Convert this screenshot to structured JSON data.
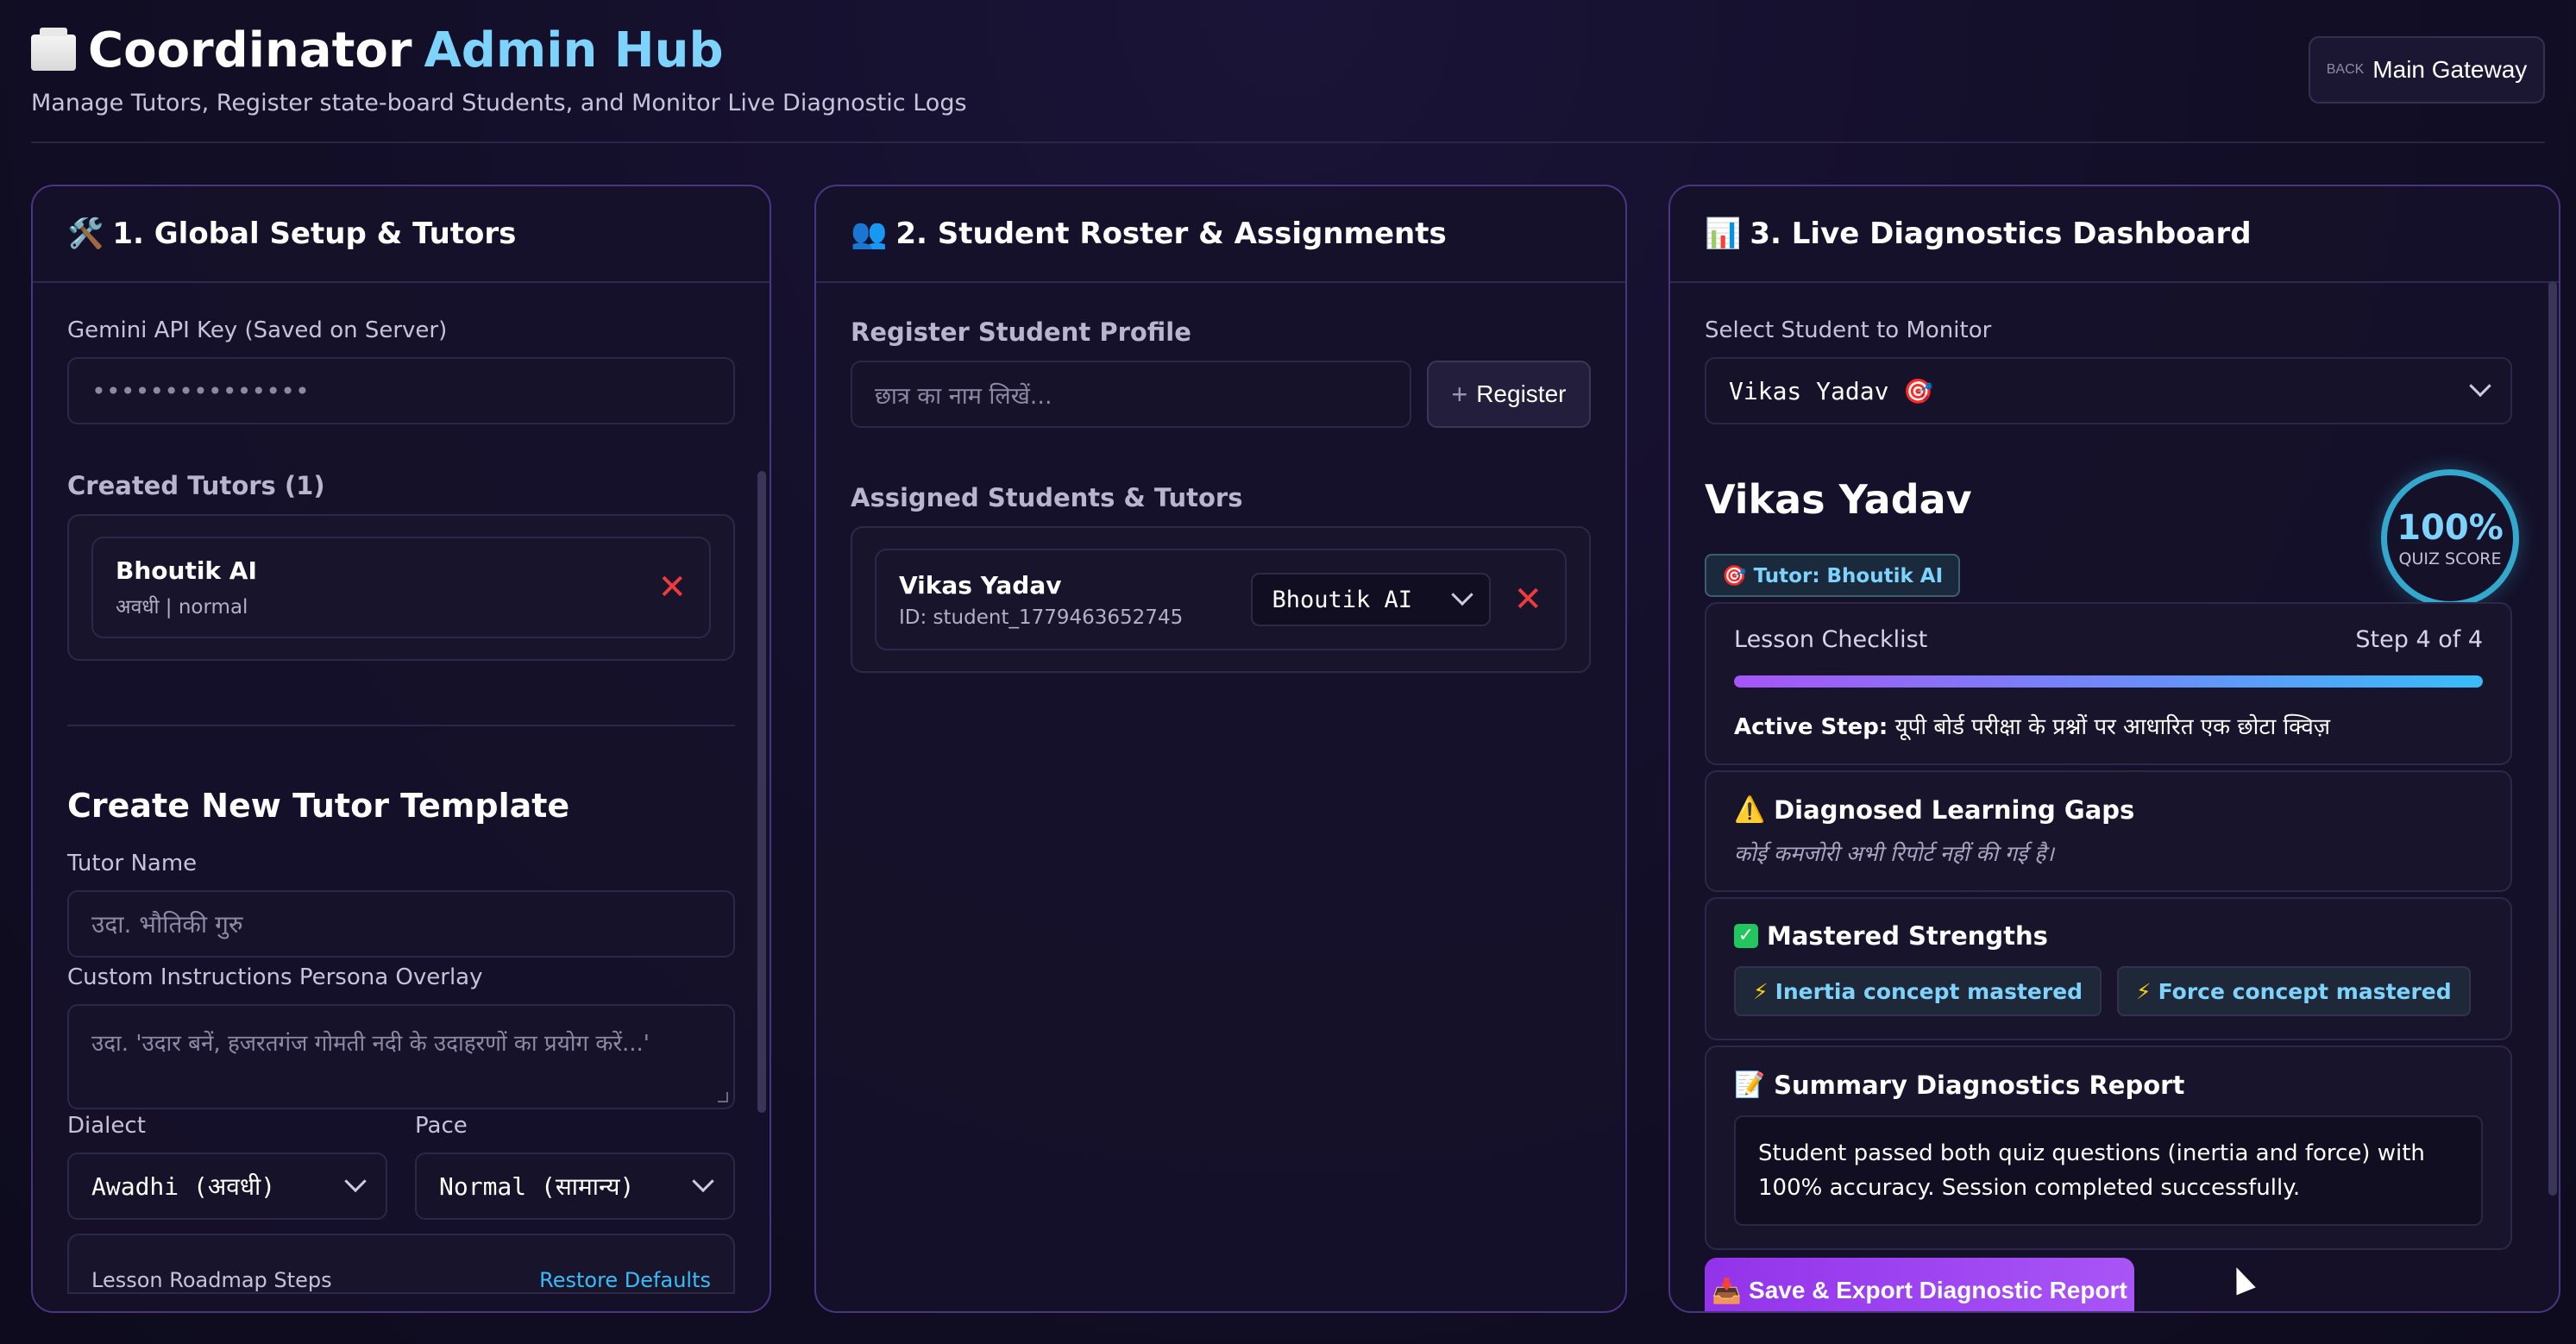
{
  "header": {
    "title_main": "Coordinator",
    "title_accent": "Admin Hub",
    "subtitle": "Manage Tutors, Register state-board Students, and Monitor Live Diagnostic Logs",
    "gateway_label": "Main Gateway",
    "gateway_icon_text": "BACK"
  },
  "setup": {
    "heading": "1. Global Setup & Tutors",
    "api_key_label": "Gemini API Key (Saved on Server)",
    "api_key_value": "•••••••••••••••",
    "created_tutors_label": "Created Tutors (1)",
    "tutors": [
      {
        "name": "Bhoutik AI",
        "meta": "अवधी | normal"
      }
    ],
    "template_title": "Create New Tutor Template",
    "tutor_name_label": "Tutor Name",
    "tutor_name_placeholder": "उदा. भौतिकी गुरु",
    "instructions_label": "Custom Instructions Persona Overlay",
    "instructions_placeholder": "उदा. 'उदार बनें, हजरतगंज गोमती नदी के उदाहरणों का प्रयोग करें...'",
    "dialect_label": "Dialect",
    "dialect_value": "Awadhi (अवधी)",
    "pace_label": "Pace",
    "pace_value": "Normal (सामान्य)",
    "roadmap_label": "Lesson Roadmap Steps",
    "restore_label": "Restore Defaults"
  },
  "roster": {
    "heading": "2. Student Roster & Assignments",
    "register_label": "Register Student Profile",
    "student_name_placeholder": "छात्र का नाम लिखें...",
    "register_button": "Register",
    "assigned_label": "Assigned Students & Tutors",
    "students": [
      {
        "name": "Vikas Yadav",
        "id": "ID: student_1779463652745",
        "tutor": "Bhoutik AI"
      }
    ]
  },
  "diagnostics": {
    "heading": "3. Live Diagnostics Dashboard",
    "select_label": "Select Student to Monitor",
    "selected_student": "Vikas Yadav 🎯",
    "student_name": "Vikas Yadav",
    "score_value": "100%",
    "score_label": "QUIZ SCORE",
    "tutor_tag": "🎯 Tutor: Bhoutik AI",
    "checklist_label": "Lesson Checklist",
    "step_text": "Step 4 of 4",
    "progress_fraction": 1.0,
    "active_step_label": "Active Step:",
    "active_step_value": "यूपी बोर्ड परीक्षा के प्रश्नों पर आधारित एक छोटा क्विज़",
    "gaps_title": "Diagnosed Learning Gaps",
    "gaps_text": "कोई कमजोरी अभी रिपोर्ट नहीं की गई है।",
    "strengths_title": "Mastered Strengths",
    "strengths": [
      "Inertia concept mastered",
      "Force concept mastered"
    ],
    "summary_title": "Summary Diagnostics Report",
    "summary_text": "Student passed both quiz questions (inertia and force) with 100% accuracy. Session completed successfully.",
    "export_button": "Save & Export Diagnostic Report"
  },
  "colors": {
    "accent": "#7dd3fc",
    "panel_border": "#4a3580",
    "danger": "#ef3b3b",
    "export": "#a855f7"
  }
}
